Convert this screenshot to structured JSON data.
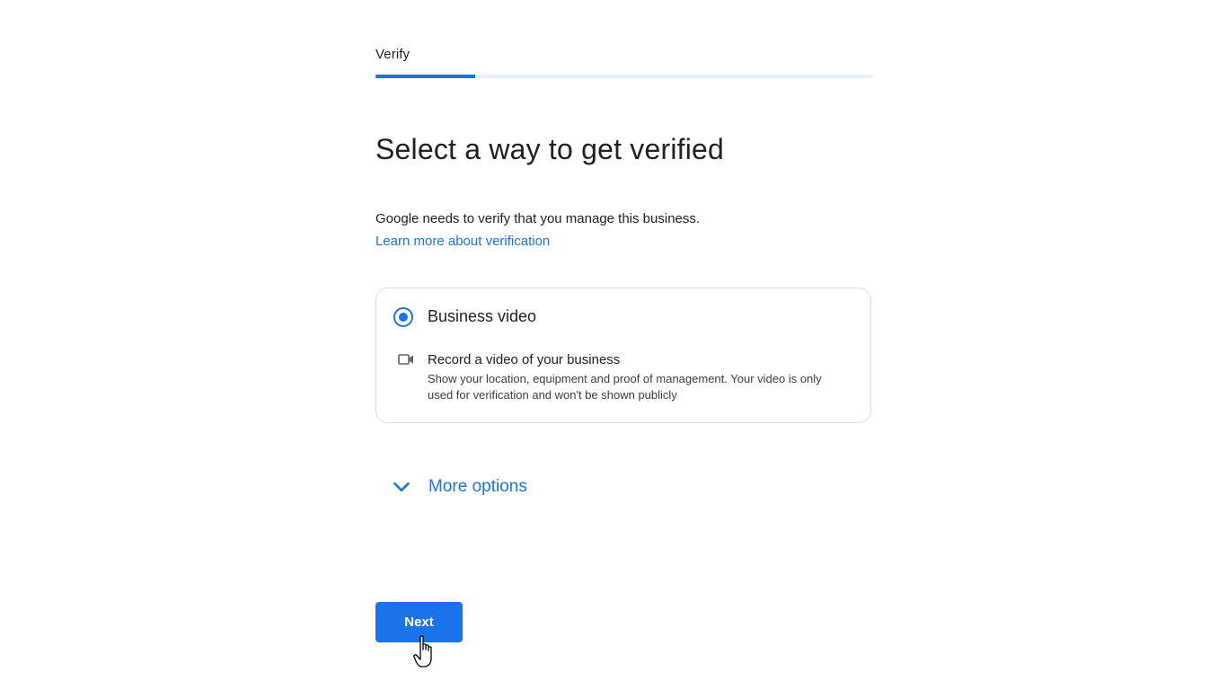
{
  "header": {
    "step_title": "Verify",
    "progress_fraction": 0.2
  },
  "main": {
    "heading": "Select a way to get verified",
    "intro_text": "Google needs to verify that you manage this business.",
    "learn_more_link": "Learn more about verification"
  },
  "option": {
    "selected": true,
    "title": "Business video",
    "icon": "video-camera-icon",
    "detail_title": "Record a video of your business",
    "detail_description": "Show your location, equipment and proof of management. Your video is only used for verification and won't be shown publicly"
  },
  "more_options": {
    "icon": "chevron-down-icon",
    "label": "More options"
  },
  "footer": {
    "next_label": "Next"
  },
  "colors": {
    "accent": "#1a73e8",
    "progress_track": "#e8f0fe",
    "card_border": "#dadce0",
    "text": "#202124"
  }
}
